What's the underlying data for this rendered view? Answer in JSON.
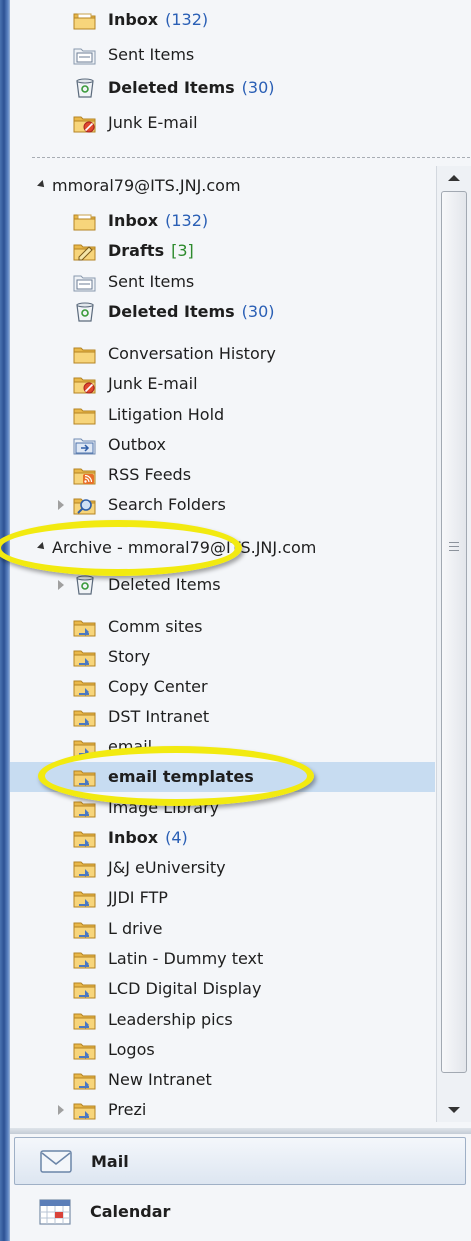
{
  "top": {
    "folders": [
      {
        "label": "Inbox",
        "count": "(132)",
        "bold": true,
        "icon": "inbox-icon"
      },
      {
        "label": "Sent Items",
        "count": "",
        "bold": false,
        "icon": "sent-items-icon"
      },
      {
        "label": "Deleted Items",
        "count": "(30)",
        "bold": true,
        "icon": "deleted-items-icon"
      },
      {
        "label": "Junk E-mail",
        "count": "",
        "bold": false,
        "icon": "junk-email-icon"
      }
    ]
  },
  "account": {
    "name": "mmoral79@ITS.JNJ.com",
    "folders": [
      {
        "label": "Inbox",
        "count": "(132)",
        "bold": true,
        "icon": "inbox-icon"
      },
      {
        "label": "Drafts",
        "count": "[3]",
        "bold": true,
        "icon": "drafts-icon"
      },
      {
        "label": "Sent Items",
        "count": "",
        "bold": false,
        "icon": "sent-items-icon"
      },
      {
        "label": "Deleted Items",
        "count": "(30)",
        "bold": true,
        "icon": "deleted-items-icon"
      },
      {
        "label": "Conversation History",
        "count": "",
        "bold": false,
        "icon": "folder-icon"
      },
      {
        "label": "Junk E-mail",
        "count": "",
        "bold": false,
        "icon": "junk-email-icon"
      },
      {
        "label": "Litigation Hold",
        "count": "",
        "bold": false,
        "icon": "folder-icon"
      },
      {
        "label": "Outbox",
        "count": "",
        "bold": false,
        "icon": "outbox-icon"
      },
      {
        "label": "RSS Feeds",
        "count": "",
        "bold": false,
        "icon": "rss-feeds-icon"
      },
      {
        "label": "Search Folders",
        "count": "",
        "bold": false,
        "icon": "search-folders-icon"
      }
    ]
  },
  "archive": {
    "name": "Archive - mmoral79@ITS.JNJ.com",
    "folders": [
      {
        "label": "Deleted Items",
        "count": "",
        "bold": false,
        "icon": "deleted-items-icon"
      },
      {
        "label": "Comm sites",
        "count": "",
        "bold": false,
        "icon": "archive-folder-icon"
      },
      {
        "label": "Story",
        "count": "",
        "bold": false,
        "icon": "archive-folder-icon"
      },
      {
        "label": "Copy Center",
        "count": "",
        "bold": false,
        "icon": "archive-folder-icon"
      },
      {
        "label": "DST Intranet",
        "count": "",
        "bold": false,
        "icon": "archive-folder-icon"
      },
      {
        "label": "email",
        "count": "",
        "bold": false,
        "icon": "archive-folder-icon"
      },
      {
        "label": "email templates",
        "count": "",
        "bold": true,
        "icon": "archive-folder-icon",
        "selected": true
      },
      {
        "label": "Image Library",
        "count": "",
        "bold": false,
        "icon": "archive-folder-icon"
      },
      {
        "label": "Inbox",
        "count": "(4)",
        "bold": true,
        "icon": "archive-folder-icon"
      },
      {
        "label": "J&J eUniversity",
        "count": "",
        "bold": false,
        "icon": "archive-folder-icon"
      },
      {
        "label": "JJDI FTP",
        "count": "",
        "bold": false,
        "icon": "archive-folder-icon"
      },
      {
        "label": "L drive",
        "count": "",
        "bold": false,
        "icon": "archive-folder-icon"
      },
      {
        "label": "Latin - Dummy text",
        "count": "",
        "bold": false,
        "icon": "archive-folder-icon"
      },
      {
        "label": "LCD Digital Display",
        "count": "",
        "bold": false,
        "icon": "archive-folder-icon"
      },
      {
        "label": "Leadership pics",
        "count": "",
        "bold": false,
        "icon": "archive-folder-icon"
      },
      {
        "label": "Logos",
        "count": "",
        "bold": false,
        "icon": "archive-folder-icon"
      },
      {
        "label": "New Intranet",
        "count": "",
        "bold": false,
        "icon": "archive-folder-icon"
      },
      {
        "label": "Prezi",
        "count": "",
        "bold": false,
        "icon": "archive-folder-icon"
      }
    ]
  },
  "nav": {
    "mail_label": "Mail",
    "calendar_label": "Calendar"
  },
  "colors": {
    "highlight": "#f2ea10",
    "selection": "#c7dcf1",
    "count_blue": "#2a5fb5",
    "count_green": "#2d8a2d"
  }
}
